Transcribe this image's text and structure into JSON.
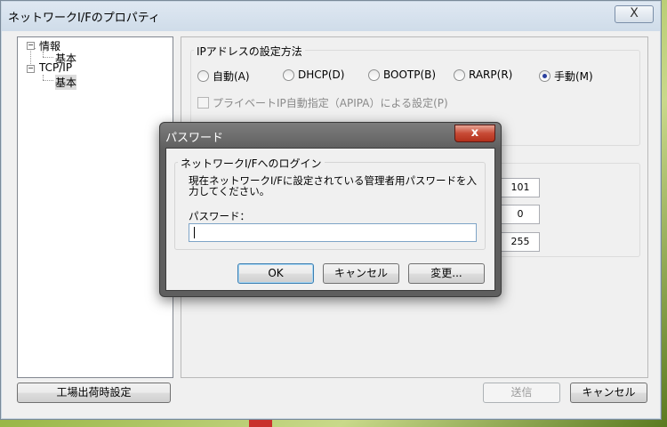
{
  "window": {
    "title": "ネットワークI/Fのプロパティ",
    "close_label": "X"
  },
  "tree": {
    "items": [
      {
        "label": "情報",
        "toggle": "−"
      },
      {
        "label": "基本"
      },
      {
        "label": "TCP/IP",
        "toggle": "−"
      },
      {
        "label": "基本"
      }
    ]
  },
  "ip_group": {
    "legend": "IPアドレスの設定方法",
    "options": [
      "自動(A)",
      "DHCP(D)",
      "BOOTP(B)",
      "RARP(R)",
      "手動(M)"
    ],
    "selected": "手動(M)",
    "apipa_label": "プライベートIP自動指定（APIPA）による設定(P)"
  },
  "fields": {
    "values": [
      "101",
      "0",
      "255"
    ]
  },
  "buttons": {
    "factory_reset": "工場出荷時設定",
    "send": "送信",
    "cancel": "キャンセル"
  },
  "dialog": {
    "title": "パスワード",
    "close_label": "x",
    "legend": "ネットワークI/Fへのログイン",
    "message": "現在ネットワークI/Fに設定されている管理者用パスワードを入力してください。",
    "password_label": "パスワード：",
    "password_value": "",
    "ok": "OK",
    "cancel": "キャンセル",
    "change": "変更..."
  }
}
